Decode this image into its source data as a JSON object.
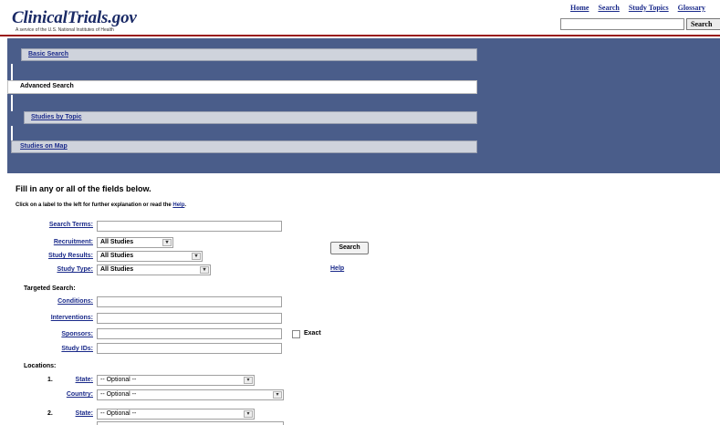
{
  "header": {
    "logo": "ClinicalTrials.gov",
    "tagline": "A service of the U.S. National Institutes of Health",
    "nav": [
      "Home",
      "Search",
      "Study Topics",
      "Glossary"
    ],
    "search_button": "Search"
  },
  "tabs": {
    "basic": "Basic Search",
    "advanced": "Advanced Search",
    "topic": "Studies by Topic",
    "map": "Studies on Map"
  },
  "form": {
    "intro": "Fill in any or all of the fields below.",
    "hint_prefix": "Click on a label to the left for further explanation or read the ",
    "hint_link": "Help",
    "hint_suffix": ".",
    "search_terms_label": "Search Terms:",
    "recruitment_label": "Recruitment:",
    "recruitment_value": "All Studies",
    "study_results_label": "Study Results:",
    "study_results_value": "All Studies",
    "study_type_label": "Study Type:",
    "study_type_value": "All Studies",
    "search_button": "Search",
    "help_link": "Help",
    "targeted_label": "Targeted Search:",
    "conditions_label": "Conditions:",
    "interventions_label": "Interventions:",
    "sponsors_label": "Sponsors:",
    "exact_label": "Exact",
    "study_ids_label": "Study IDs:",
    "locations_label": "Locations:",
    "location_rows": [
      {
        "num": "1.",
        "state_label": "State:",
        "state_value": "-- Optional --",
        "country_label": "Country:",
        "country_value": "-- Optional --"
      },
      {
        "num": "2.",
        "state_label": "State:",
        "state_value": "-- Optional --"
      }
    ]
  },
  "colors": {
    "tab_region": "#4a5d8a",
    "link": "#1a2a8a",
    "header_rule": "#9a1b1b"
  }
}
